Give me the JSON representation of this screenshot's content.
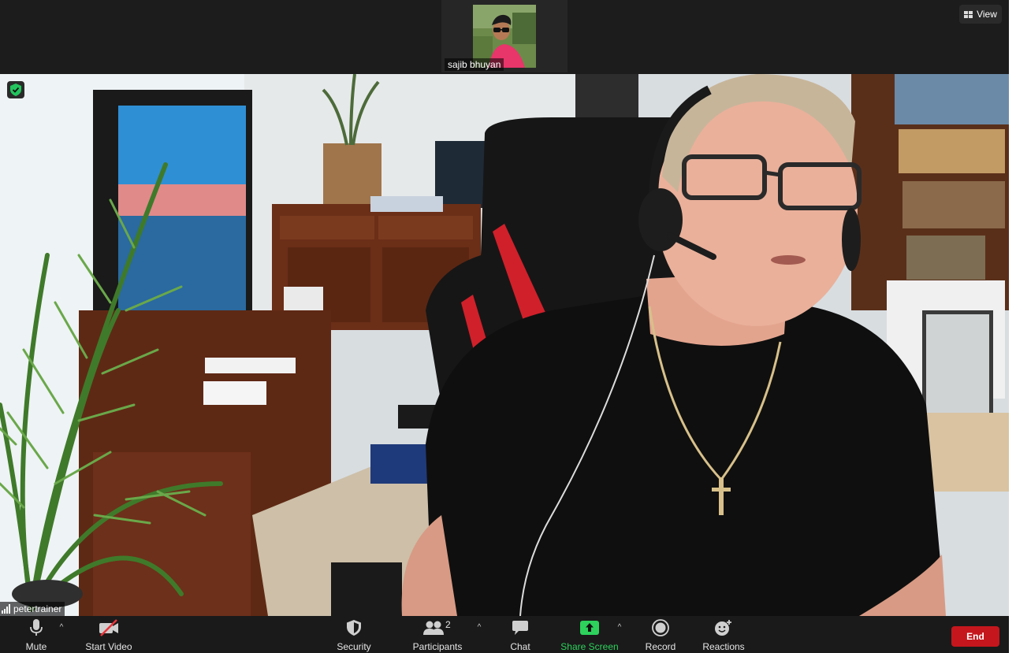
{
  "top_strip": {
    "thumbnail_name": "sajib bhuyan",
    "view_label": "View"
  },
  "main_video": {
    "participant_name": "petertrainer"
  },
  "toolbar": {
    "mute_label": "Mute",
    "start_video_label": "Start Video",
    "security_label": "Security",
    "participants_label": "Participants",
    "participants_count": "2",
    "chat_label": "Chat",
    "share_screen_label": "Share Screen",
    "record_label": "Record",
    "reactions_label": "Reactions",
    "end_label": "End"
  },
  "colors": {
    "share_green": "#2dd15c",
    "end_red": "#c5161d",
    "shield_green": "#23c55e"
  }
}
